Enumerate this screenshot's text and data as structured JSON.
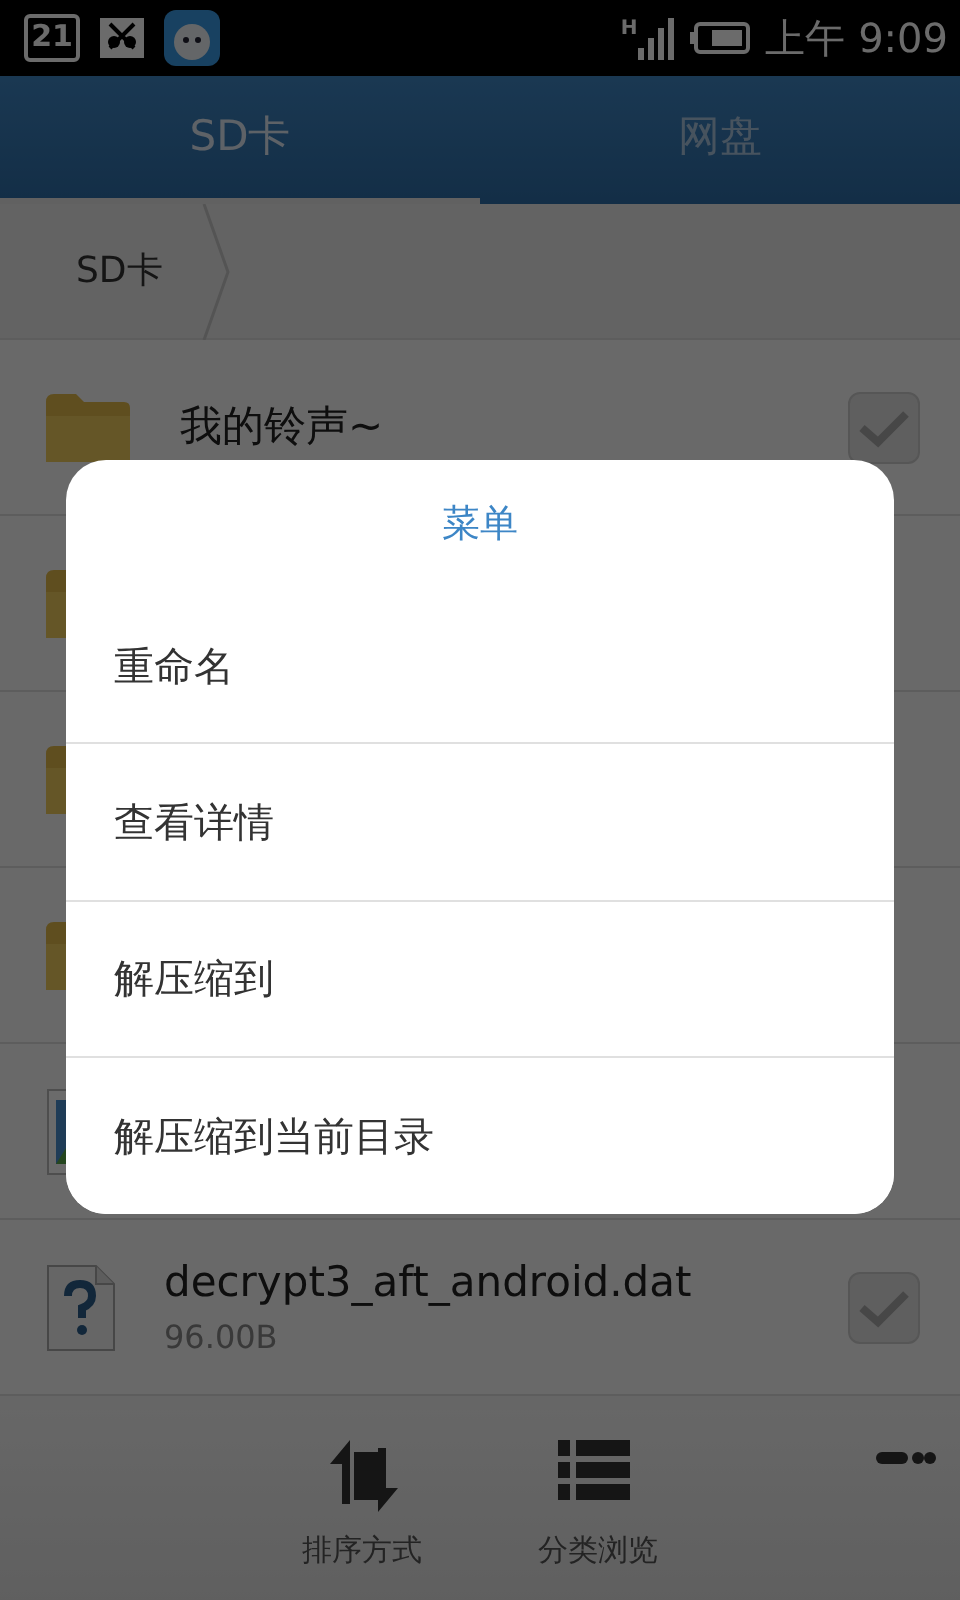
{
  "status_bar": {
    "calendar_day": "21",
    "network_type": "H",
    "time": "上午 9:09"
  },
  "tabs": [
    {
      "label": "SD卡",
      "selected": true
    },
    {
      "label": "网盘",
      "selected": false
    }
  ],
  "breadcrumb": [
    "SD卡"
  ],
  "files": [
    {
      "kind": "folder",
      "name": "我的铃声~",
      "checked": false
    },
    {
      "kind": "folder"
    },
    {
      "kind": "folder"
    },
    {
      "kind": "folder"
    },
    {
      "kind": "image"
    },
    {
      "kind": "unknown",
      "name": "decrypt3_aft_android.dat",
      "detail": "96.00B",
      "checked": false
    }
  ],
  "toolbar": [
    {
      "kind": "sort",
      "label": "排序方式"
    },
    {
      "kind": "category",
      "label": "分类浏览"
    }
  ],
  "menu": {
    "title": "菜单",
    "items": [
      "重命名",
      "查看详情",
      "解压缩到",
      "解压缩到当前目录"
    ]
  }
}
